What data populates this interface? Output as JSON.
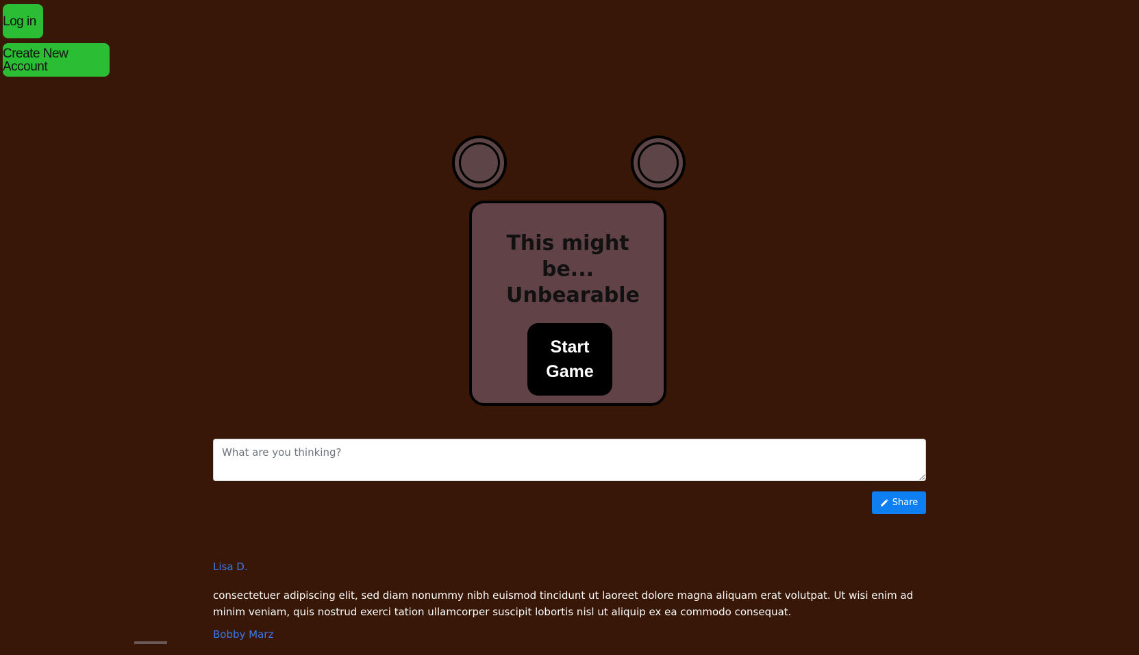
{
  "auth": {
    "login_label": "Log in",
    "create_account_label": "Create New Account"
  },
  "hero": {
    "headline": "This might be... Unbearable",
    "start_label": "Start Game"
  },
  "composer": {
    "placeholder": "What are you thinking?",
    "share_label": "Share",
    "share_icon": "pencil-icon"
  },
  "comments": [
    {
      "author": "Lisa D.",
      "text": "consectetuer adipiscing elit, sed diam nonummy nibh euismod tincidunt ut laoreet dolore magna aliquam erat volutpat. Ut wisi enim ad minim veniam, quis nostrud exerci tation ullamcorper suscipit lobortis nisl ut aliquip ex ea commodo consequat."
    },
    {
      "author": "Bobby Marz",
      "text": ""
    }
  ],
  "colors": {
    "background": "#381706",
    "bear_fill": "#614347",
    "auth_button": "#2bbd33",
    "share_button": "#0d7ff2",
    "link": "#3a7ae8"
  }
}
